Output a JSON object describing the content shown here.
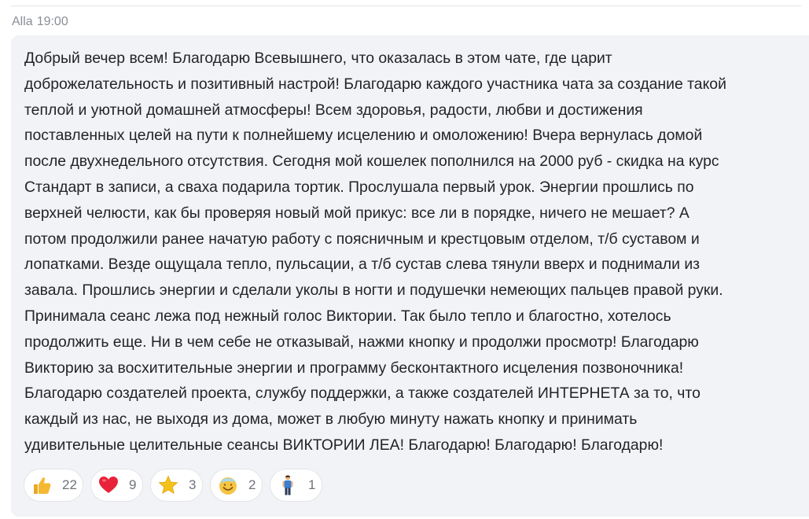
{
  "message": {
    "author": "Alla",
    "time": "19:00",
    "text": "Добрый вечер всем! Благодарю Всевышнего, что оказалась в этом чате, где  царит\nдоброжелательность и позитивный настрой! Благодарю каждого участника чата за создание такой\nтеплой и уютной домашней атмосферы! Всем здоровья,  радости, любви и достижения\nпоставленных целей на пути к полнейшему исцелению и омоложению! Вчера вернулась домой\nпосле двухнедельного отсутствия. Сегодня  мой кошелек пополнился на 2000 руб - скидка на курс\nСтандарт в записи, а сваха подарила тортик.  Прослушала первый урок. Энергии прошлись по\nверхней челюсти,  как бы проверяя новый мой прикус: все ли в порядке, ничего не мешает? А\nпотом продолжили ранее начатую работу с поясничным и крестцовым отделом, т/б суставом и\nлопатками. Везде ощущала тепло, пульсации, а т/б сустав слева тянули  вверх и поднимали из\nзавала. Прошлись энергии  и сделали уколы в ногти и подушечки немеющих пальцев  правой руки.\nПринимала сеанс лежа  под нежный голос Виктории. Так было тепло  и благостно, хотелось\nпродолжить еще. Ни в чем себе не отказывай, нажми кнопку и продолжи просмотр! Благодарю\nВикторию за восхитительные энергии и программу бесконтактного исцеления позвоночника!\nБлагодарю  создателей проекта,  службу поддержки, а также создателей ИНТЕРНЕТА за то, что\nкаждый из нас,  не выходя из дома,  может  в любую минуту нажать кнопку и принимать\nудивительные целительные сеансы ВИКТОРИИ ЛЕА! Благодарю!  Благодарю! Благодарю!"
  },
  "reactions": [
    {
      "icon": "thumbs-up-icon",
      "count": "22"
    },
    {
      "icon": "heart-icon",
      "count": "9"
    },
    {
      "icon": "star-icon",
      "count": "3"
    },
    {
      "icon": "smiling-face-icon",
      "count": "2"
    },
    {
      "icon": "man-standing-icon",
      "count": "1"
    }
  ],
  "colors": {
    "bubble": "#f1f3f6",
    "text": "#222426",
    "meta": "#8a8f96",
    "heart": "#e8223a",
    "star": "#f4c21a",
    "thumb": "#f5b833"
  }
}
